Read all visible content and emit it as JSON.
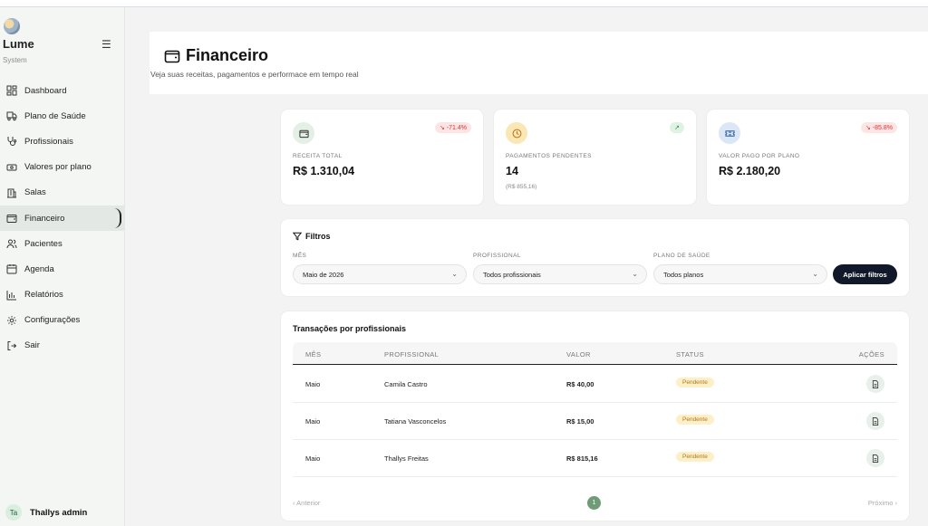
{
  "sidebar": {
    "brand": "Lume",
    "brand_sub": "System",
    "items": [
      {
        "label": "Dashboard",
        "icon": "dashboard-grid-icon"
      },
      {
        "label": "Plano de Saúde",
        "icon": "truck-icon"
      },
      {
        "label": "Profissionais",
        "icon": "stethoscope-icon"
      },
      {
        "label": "Valores por plano",
        "icon": "banknote-icon"
      },
      {
        "label": "Salas",
        "icon": "building-icon"
      },
      {
        "label": "Financeiro",
        "icon": "wallet-icon",
        "active": true
      },
      {
        "label": "Pacientes",
        "icon": "users-icon"
      },
      {
        "label": "Agenda",
        "icon": "calendar-icon"
      },
      {
        "label": "Relatórios",
        "icon": "bar-chart-icon"
      },
      {
        "label": "Configurações",
        "icon": "gear-icon"
      },
      {
        "label": "Sair",
        "icon": "logout-icon"
      }
    ],
    "user": {
      "initials": "Ta",
      "name": "Thallys admin"
    }
  },
  "header": {
    "title": "Financeiro",
    "subtitle": "Veja suas receitas, pagamentos e performace em tempo real"
  },
  "stats": [
    {
      "label": "RECEITA TOTAL",
      "value": "R$ 1.310,04",
      "badge": "↘ -71.4%",
      "badge_type": "negative",
      "icon": "wallet-icon",
      "icon_bg": "#e4efe6"
    },
    {
      "label": "PAGAMENTOS PENDENTES",
      "value": "14",
      "extra": "(R$ 855,16)",
      "badge": "↗",
      "badge_type": "positive",
      "icon": "clock-icon",
      "icon_bg": "#fbe7b4"
    },
    {
      "label": "VALOR PAGO POR PLANO",
      "value": "R$ 2.180,20",
      "badge": "↘ -85.8%",
      "badge_type": "negative",
      "icon": "ticket-icon",
      "icon_bg": "#dbe7f6"
    }
  ],
  "filters": {
    "title": "Filtros",
    "month_label": "MÊS",
    "month_value": "Maio de 2026",
    "professional_label": "PROFISSIONAL",
    "professional_value": "Todos profissionais",
    "plan_label": "PLANO DE SAÚDE",
    "plan_value": "Todos planos",
    "apply_label": "Aplicar filtros"
  },
  "table": {
    "title": "Transações por profissionais",
    "columns": [
      "MÊS",
      "PROFISSIONAL",
      "VALOR",
      "STATUS",
      "AÇÕES"
    ],
    "rows": [
      {
        "month": "Maio",
        "professional": "Camila Castro",
        "value": "R$ 40,00",
        "status": "Pendente"
      },
      {
        "month": "Maio",
        "professional": "Tatiana Vasconcelos",
        "value": "R$ 15,00",
        "status": "Pendente"
      },
      {
        "month": "Maio",
        "professional": "Thallys Freitas",
        "value": "R$ 815,16",
        "status": "Pendente"
      }
    ],
    "prev_label": "‹  Anterior",
    "next_label": "Próximo  ›",
    "current_page": "1"
  },
  "colors": {
    "accent": "#101829",
    "active_page": "#6f9c76",
    "pending": "#b8731a",
    "negative": "#d33",
    "positive": "#2b8a4a"
  }
}
